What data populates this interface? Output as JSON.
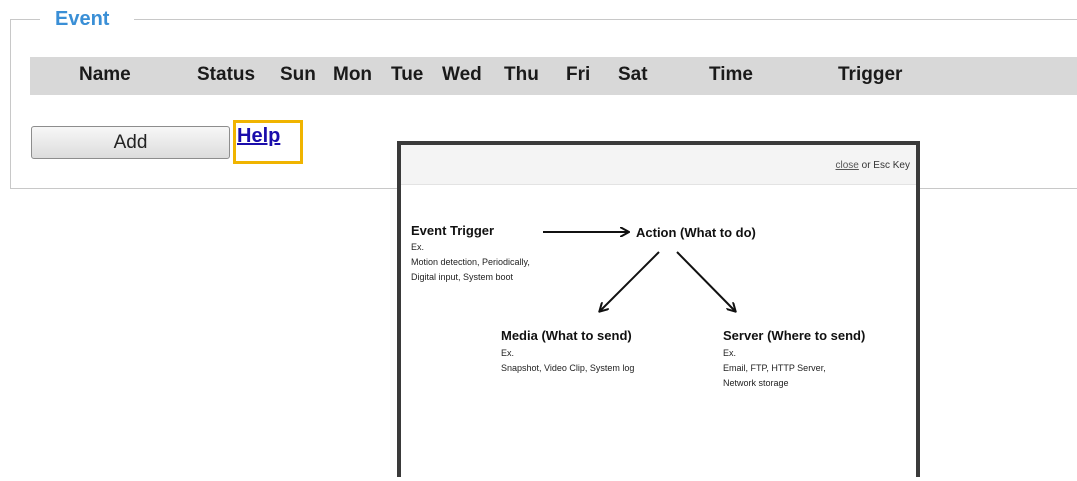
{
  "event": {
    "legend": "Event",
    "columns": [
      "Name",
      "Status",
      "Sun",
      "Mon",
      "Tue",
      "Wed",
      "Thu",
      "Fri",
      "Sat",
      "Time",
      "Trigger"
    ],
    "add_label": "Add",
    "help_label": "Help"
  },
  "popup": {
    "close_label": "close",
    "close_suffix": "or Esc Key",
    "trigger": {
      "title": "Event Trigger",
      "lines": [
        "Ex.",
        "Motion detection, Periodically,",
        "Digital input, System boot"
      ]
    },
    "action": {
      "title": "Action (What to do)"
    },
    "media": {
      "title": "Media (What to send)",
      "lines": [
        "Ex.",
        "Snapshot, Video Clip, System log"
      ]
    },
    "server": {
      "title": "Server (Where to send)",
      "lines": [
        "Ex.",
        "Email, FTP, HTTP Server,",
        "Network storage"
      ]
    }
  },
  "colors": {
    "legend": "#3a8fd6",
    "header_bar": "#d8d8d8",
    "help_highlight": "#f0b400",
    "link": "#1a0dab"
  }
}
